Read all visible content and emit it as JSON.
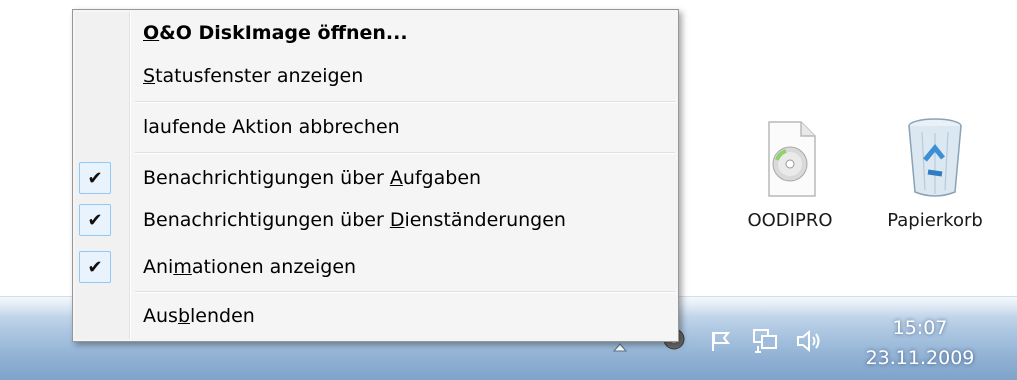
{
  "menu": {
    "items": [
      {
        "label": "O&O DiskImage öffnen...",
        "pre": "",
        "accel": "O",
        "post": "&O DiskImage öffnen...",
        "bold": true
      },
      {
        "label": "Statusfenster anzeigen",
        "pre": "",
        "accel": "S",
        "post": "tatusfenster anzeigen"
      },
      {
        "label": "laufende Aktion abbrechen",
        "pre": "laufende Aktion abbrechen",
        "accel": "",
        "post": ""
      },
      {
        "label": "Benachrichtigungen über Aufgaben",
        "pre": "Benachrichtigungen über ",
        "accel": "A",
        "post": "ufgaben",
        "checked": true
      },
      {
        "label": "Benachrichtigungen über Dienständerungen",
        "pre": "Benachrichtigungen über ",
        "accel": "D",
        "post": "ienständerungen",
        "checked": true
      },
      {
        "label": "Animationen anzeigen",
        "pre": "Ani",
        "accel": "m",
        "post": "ationen anzeigen",
        "checked": true
      },
      {
        "label": "Ausblenden",
        "pre": "Aus",
        "accel": "b",
        "post": "lenden"
      }
    ],
    "check_glyph": "✔"
  },
  "desktop": {
    "icons": [
      {
        "label": "OODIPRO",
        "icon": "disc-file-icon"
      },
      {
        "label": "Papierkorb",
        "icon": "recycle-bin-icon"
      }
    ]
  },
  "taskbar": {
    "clock": {
      "time": "15:07",
      "date": "23.11.2009"
    },
    "tray_icons": [
      "show-hidden-icons-arrow",
      "oo-diskimage-tray-icon",
      "action-center-flag-icon",
      "network-icon",
      "volume-icon"
    ]
  },
  "colors": {
    "taskbar": "#9fbcdc",
    "check_box_border": "#90c8f6",
    "check_box_fill": "#e8f3fd"
  }
}
